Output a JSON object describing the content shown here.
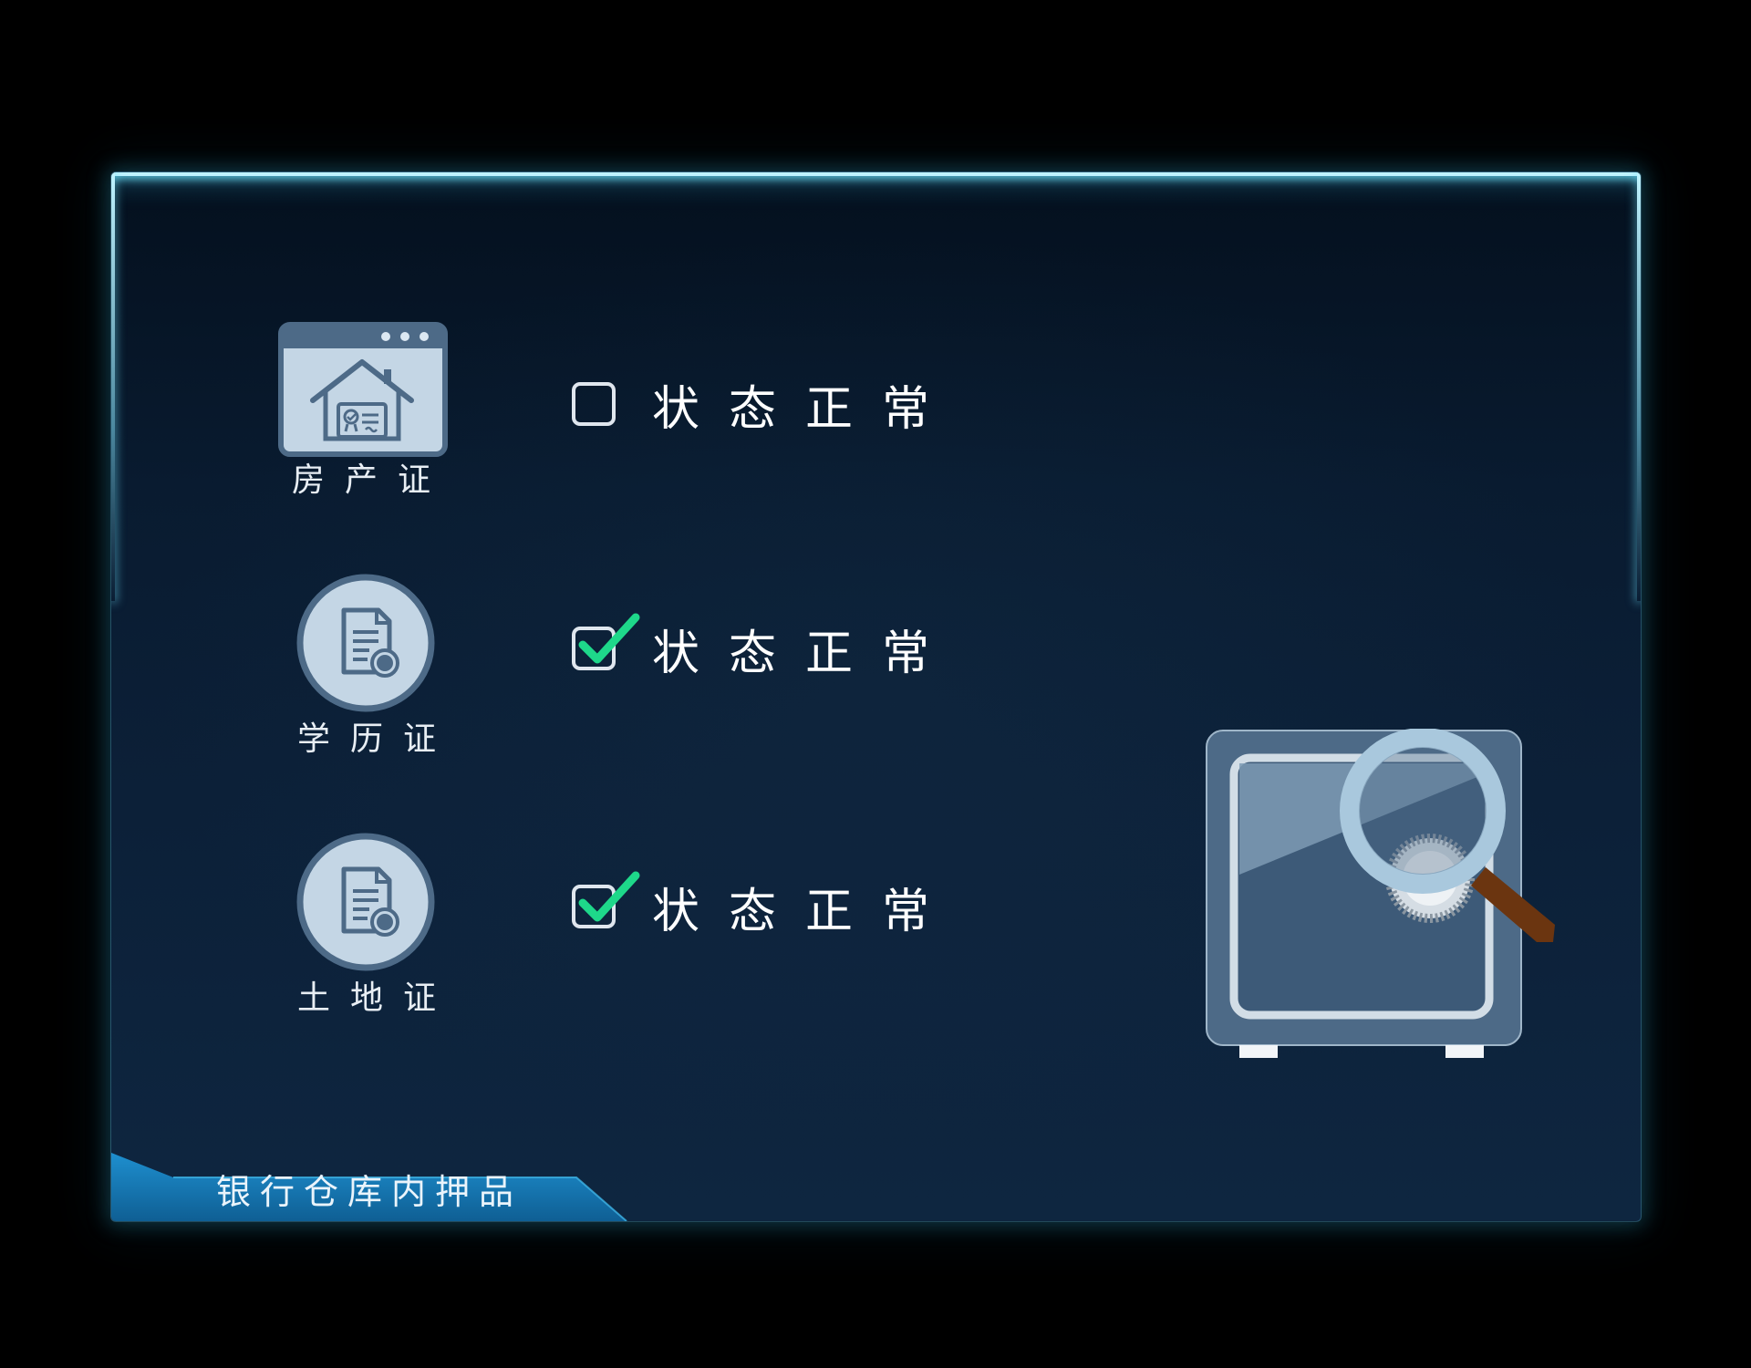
{
  "panel": {
    "title": "银行仓库内押品"
  },
  "documents": [
    {
      "label": "房产证",
      "icon": "house-certificate-icon",
      "checked": false,
      "status": "状态正常"
    },
    {
      "label": "学历证",
      "icon": "document-seal-icon",
      "checked": true,
      "status": "状态正常"
    },
    {
      "label": "土地证",
      "icon": "document-seal-icon",
      "checked": true,
      "status": "状态正常"
    }
  ],
  "illustration": {
    "icon": "safe-with-magnifier-icon"
  },
  "colors": {
    "accent_glow": "#bff3ff",
    "check_green": "#1ed88a",
    "icon_fill": "#c4d6e5",
    "icon_border": "#4d6a87",
    "tab_blue": "#1d82c0"
  }
}
